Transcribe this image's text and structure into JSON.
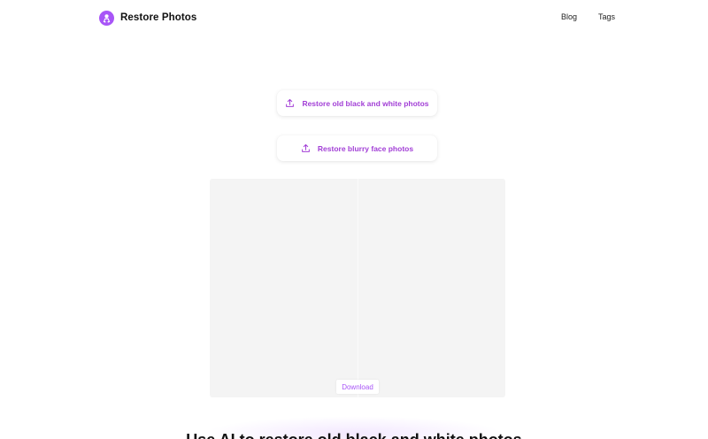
{
  "header": {
    "brand_name": "Restore Photos",
    "logo_icon": "person-logo-icon",
    "nav": [
      {
        "label": "Blog"
      },
      {
        "label": "Tags"
      }
    ]
  },
  "actions": {
    "restore_bw_label": "Restore old black and white photos",
    "restore_face_label": "Restore blurry face photos",
    "icon": "upload-icon"
  },
  "viewer": {
    "download_label": "Download"
  },
  "hero": {
    "title": "Use AI to restore old black and white photos"
  },
  "colors": {
    "accent": "#a855f7",
    "accent_text": "#a23fd6",
    "viewer_bg": "#f4f4f4"
  }
}
